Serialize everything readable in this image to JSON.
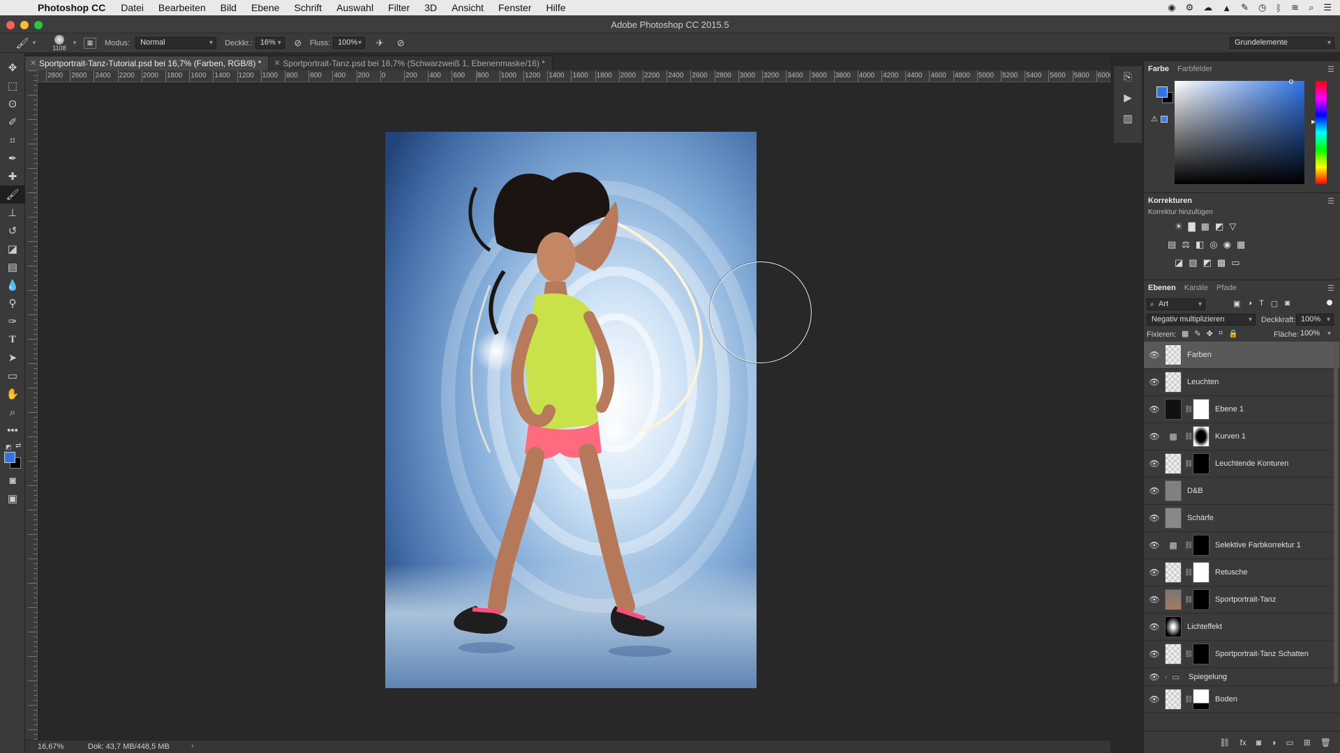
{
  "menubar": {
    "app": "Photoshop CC",
    "items": [
      "Datei",
      "Bearbeiten",
      "Bild",
      "Ebene",
      "Schrift",
      "Auswahl",
      "Filter",
      "3D",
      "Ansicht",
      "Fenster",
      "Hilfe"
    ]
  },
  "window": {
    "title": "Adobe Photoshop CC 2015.5"
  },
  "options": {
    "brush_size": "1108",
    "mode_label": "Modus:",
    "mode_value": "Normal",
    "opacity_label": "Deckkr.:",
    "opacity_value": "16%",
    "flow_label": "Fluss:",
    "flow_value": "100%",
    "workspace": "Grundelemente"
  },
  "tabs": [
    {
      "label": "Sportportrait-Tanz-Tutorial.psd bei 16,7% (Farben, RGB/8) *",
      "active": true
    },
    {
      "label": "Sportportrait-Tanz.psd bei 16,7% (Schwarzweiß 1, Ebenenmaske/16) *",
      "active": false
    }
  ],
  "ruler": {
    "h_ticks": [
      "2800",
      "2600",
      "2400",
      "2200",
      "2000",
      "1800",
      "1600",
      "1400",
      "1200",
      "1000",
      "800",
      "600",
      "400",
      "200",
      "0",
      "200",
      "400",
      "600",
      "800",
      "1000",
      "1200",
      "1400",
      "1600",
      "1800",
      "2000",
      "2200",
      "2400",
      "2600",
      "2800",
      "3000",
      "3200",
      "3400",
      "3600",
      "3800",
      "4000",
      "4200",
      "4400",
      "4600",
      "4800",
      "5000",
      "5200",
      "5400",
      "5600",
      "5800",
      "6000"
    ]
  },
  "status": {
    "zoom": "16,67%",
    "doc": "Dok: 43,7 MB/448,5 MB"
  },
  "color_panel": {
    "tab_active": "Farbe",
    "tab_other": "Farbfelder",
    "fg_color": "#2f74e6",
    "bg_color": "#000000"
  },
  "adjustments": {
    "title": "Korrekturen",
    "subtitle": "Korrektur hinzufügen"
  },
  "layers_panel": {
    "tabs": [
      "Ebenen",
      "Kanäle",
      "Pfade"
    ],
    "filter": "Art",
    "blend_mode": "Negativ multiplizieren",
    "opacity_label": "Deckkraft:",
    "opacity_value": "100%",
    "lock_label": "Fixieren:",
    "fill_label": "Fläche:",
    "fill_value": "100%",
    "layers": [
      {
        "name": "Farben",
        "selected": true
      },
      {
        "name": "Leuchten"
      },
      {
        "name": "Ebene 1"
      },
      {
        "name": "Kurven 1"
      },
      {
        "name": "Leuchtende Konturen"
      },
      {
        "name": "D&B"
      },
      {
        "name": "Schärfe"
      },
      {
        "name": "Selektive Farbkorrektur 1"
      },
      {
        "name": "Retusche"
      },
      {
        "name": "Sportportrait-Tanz"
      },
      {
        "name": "Lichteffekt"
      },
      {
        "name": "Sportportrait-Tanz Schatten"
      },
      {
        "name": "Spiegelung"
      },
      {
        "name": "Boden"
      }
    ]
  }
}
